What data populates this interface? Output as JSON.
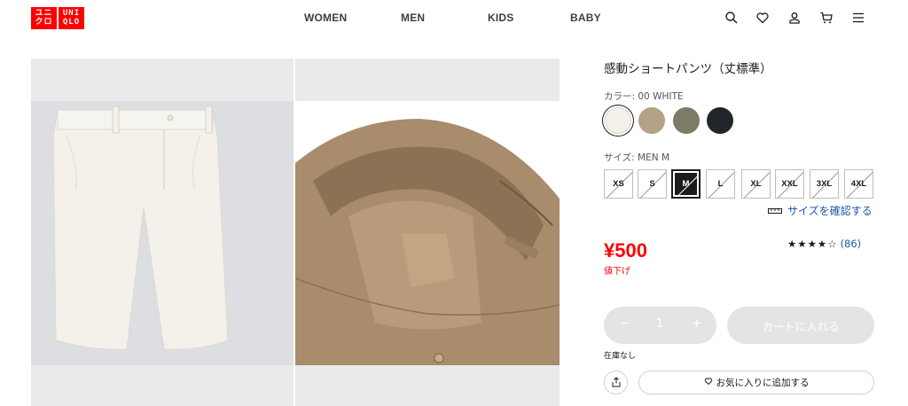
{
  "header": {
    "logo_top": "ユニ UNI",
    "logo_bottom": "クロ QLO",
    "logo_l1": "ユニ",
    "logo_l2": "クロ",
    "logo_r1": "UNI",
    "logo_r2": "QLO",
    "nav": [
      "WOMEN",
      "MEN",
      "KIDS",
      "BABY"
    ],
    "icons": [
      "search-icon",
      "heart-icon",
      "account-icon",
      "cart-icon",
      "menu-icon"
    ],
    "brand_color": "#ff0000"
  },
  "gallery": {
    "images": [
      {
        "name": "front-view",
        "color": "#f3f1ea"
      },
      {
        "name": "waistband-detail",
        "color": "#a6896a"
      }
    ]
  },
  "product": {
    "title": "感動ショートパンツ（丈標準）",
    "color_label": "カラー: 00 WHITE",
    "swatches": [
      {
        "name": "white",
        "hex": "#f3f1ea",
        "selected": true
      },
      {
        "name": "beige",
        "hex": "#b5a088",
        "selected": false
      },
      {
        "name": "olive",
        "hex": "#7d7a68",
        "selected": false
      },
      {
        "name": "navy",
        "hex": "#23252c",
        "selected": false
      }
    ],
    "size_label": "サイズ: MEN M",
    "sizes": [
      "XS",
      "S",
      "M",
      "L",
      "XL",
      "XXL",
      "3XL",
      "4XL"
    ],
    "selected_size": "M",
    "size_check": "サイズを確認する",
    "price": "¥500",
    "price_note": "値下げ",
    "rating_stars": "★★★★☆",
    "rating_value": 4.5,
    "rating_count": "(86)",
    "quantity": "1",
    "minus": "−",
    "plus": "+",
    "add_to_cart": "カートに入れる",
    "stock": "在庫なし",
    "favorite": "お気に入りに追加する",
    "link_color": "#1f56a8",
    "sale_color": "#ff0000"
  }
}
